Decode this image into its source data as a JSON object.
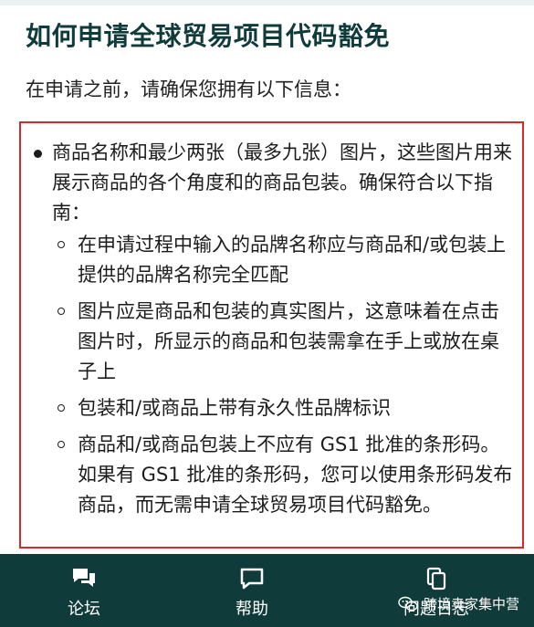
{
  "page": {
    "title": "如何申请全球贸易项目代码豁免",
    "intro": "在申请之前，请确保您拥有以下信息："
  },
  "requirements": {
    "main_text": "商品名称和最少两张（最多九张）图片，这些图片用来展示商品的各个角度和的商品包装。确保符合以下指南：",
    "sub_items": [
      "在申请过程中输入的品牌名称应与商品和/或包装上提供的品牌名称完全匹配",
      "图片应是商品和包装的真实图片，这意味着在点击图片时，所显示的商品和包装需拿在手上或放在桌子上",
      "包装和/或商品上带有永久性品牌标识",
      "商品和/或商品包装上不应有 GS1 批准的条形码。如果有 GS1 批准的条形码，您可以使用条形码发布商品，而无需申请全球贸易项目代码豁免。"
    ]
  },
  "bottom_nav": {
    "forum_label": "论坛",
    "forum_icon": "chat-bubbles-icon",
    "help_label": "帮助",
    "help_icon": "speech-bubble-icon",
    "log_label": "问题日志",
    "log_icon": "copy-icon"
  },
  "watermark": {
    "text": "跨境卖家集中营",
    "icon": "wechat-icon"
  },
  "colors": {
    "title": "#0f3b3a",
    "bottom_bar": "#0f3b3a",
    "highlight_border": "#d42a2a"
  }
}
